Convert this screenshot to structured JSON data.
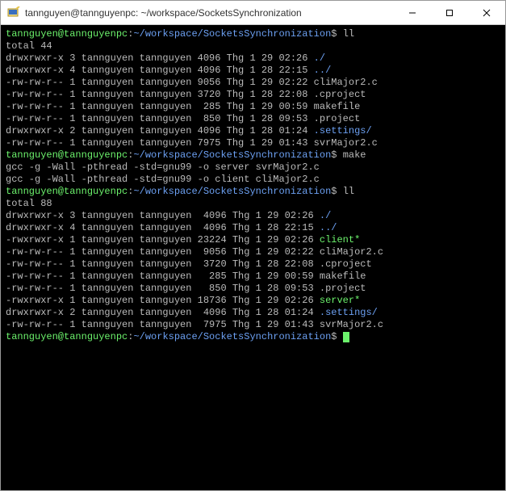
{
  "window": {
    "title": "tannguyen@tannguyenpc: ~/workspace/SocketsSynchronization"
  },
  "prompt": {
    "userhost": "tannguyen@tannguyenpc",
    "sep": ":",
    "path": "~/workspace/SocketsSynchronization",
    "sigil": "$"
  },
  "cmds": {
    "ll1": "ll",
    "make": "make",
    "ll2": "ll"
  },
  "gcc": {
    "l1": "gcc -g -Wall -pthread -std=gnu99 -o server svrMajor2.c",
    "l2": "gcc -g -Wall -pthread -std=gnu99 -o client cliMajor2.c"
  },
  "ls1": {
    "total": "total 44",
    "rows": [
      {
        "perm": "drwxrwxr-x",
        "n": "3",
        "u": "tannguyen",
        "g": "tannguyen",
        "size": "4096",
        "date": "Thg 1 29 02:26",
        "name": "./",
        "cls": "dir"
      },
      {
        "perm": "drwxrwxr-x",
        "n": "4",
        "u": "tannguyen",
        "g": "tannguyen",
        "size": "4096",
        "date": "Thg 1 28 22:15",
        "name": "../",
        "cls": "dir"
      },
      {
        "perm": "-rw-rw-r--",
        "n": "1",
        "u": "tannguyen",
        "g": "tannguyen",
        "size": "9056",
        "date": "Thg 1 29 02:22",
        "name": "cliMajor2.c",
        "cls": "out"
      },
      {
        "perm": "-rw-rw-r--",
        "n": "1",
        "u": "tannguyen",
        "g": "tannguyen",
        "size": "3720",
        "date": "Thg 1 28 22:08",
        "name": ".cproject",
        "cls": "out"
      },
      {
        "perm": "-rw-rw-r--",
        "n": "1",
        "u": "tannguyen",
        "g": "tannguyen",
        "size": " 285",
        "date": "Thg 1 29 00:59",
        "name": "makefile",
        "cls": "out"
      },
      {
        "perm": "-rw-rw-r--",
        "n": "1",
        "u": "tannguyen",
        "g": "tannguyen",
        "size": " 850",
        "date": "Thg 1 28 09:53",
        "name": ".project",
        "cls": "out"
      },
      {
        "perm": "drwxrwxr-x",
        "n": "2",
        "u": "tannguyen",
        "g": "tannguyen",
        "size": "4096",
        "date": "Thg 1 28 01:24",
        "name": ".settings/",
        "cls": "dir"
      },
      {
        "perm": "-rw-rw-r--",
        "n": "1",
        "u": "tannguyen",
        "g": "tannguyen",
        "size": "7975",
        "date": "Thg 1 29 01:43",
        "name": "svrMajor2.c",
        "cls": "out"
      }
    ]
  },
  "ls2": {
    "total": "total 88",
    "rows": [
      {
        "perm": "drwxrwxr-x",
        "n": "3",
        "u": "tannguyen",
        "g": "tannguyen",
        "size": " 4096",
        "date": "Thg 1 29 02:26",
        "name": "./",
        "cls": "dir"
      },
      {
        "perm": "drwxrwxr-x",
        "n": "4",
        "u": "tannguyen",
        "g": "tannguyen",
        "size": " 4096",
        "date": "Thg 1 28 22:15",
        "name": "../",
        "cls": "dir"
      },
      {
        "perm": "-rwxrwxr-x",
        "n": "1",
        "u": "tannguyen",
        "g": "tannguyen",
        "size": "23224",
        "date": "Thg 1 29 02:26",
        "name": "client*",
        "cls": "exec"
      },
      {
        "perm": "-rw-rw-r--",
        "n": "1",
        "u": "tannguyen",
        "g": "tannguyen",
        "size": " 9056",
        "date": "Thg 1 29 02:22",
        "name": "cliMajor2.c",
        "cls": "out"
      },
      {
        "perm": "-rw-rw-r--",
        "n": "1",
        "u": "tannguyen",
        "g": "tannguyen",
        "size": " 3720",
        "date": "Thg 1 28 22:08",
        "name": ".cproject",
        "cls": "out"
      },
      {
        "perm": "-rw-rw-r--",
        "n": "1",
        "u": "tannguyen",
        "g": "tannguyen",
        "size": "  285",
        "date": "Thg 1 29 00:59",
        "name": "makefile",
        "cls": "out"
      },
      {
        "perm": "-rw-rw-r--",
        "n": "1",
        "u": "tannguyen",
        "g": "tannguyen",
        "size": "  850",
        "date": "Thg 1 28 09:53",
        "name": ".project",
        "cls": "out"
      },
      {
        "perm": "-rwxrwxr-x",
        "n": "1",
        "u": "tannguyen",
        "g": "tannguyen",
        "size": "18736",
        "date": "Thg 1 29 02:26",
        "name": "server*",
        "cls": "exec"
      },
      {
        "perm": "drwxrwxr-x",
        "n": "2",
        "u": "tannguyen",
        "g": "tannguyen",
        "size": " 4096",
        "date": "Thg 1 28 01:24",
        "name": ".settings/",
        "cls": "dir"
      },
      {
        "perm": "-rw-rw-r--",
        "n": "1",
        "u": "tannguyen",
        "g": "tannguyen",
        "size": " 7975",
        "date": "Thg 1 29 01:43",
        "name": "svrMajor2.c",
        "cls": "out"
      }
    ]
  }
}
